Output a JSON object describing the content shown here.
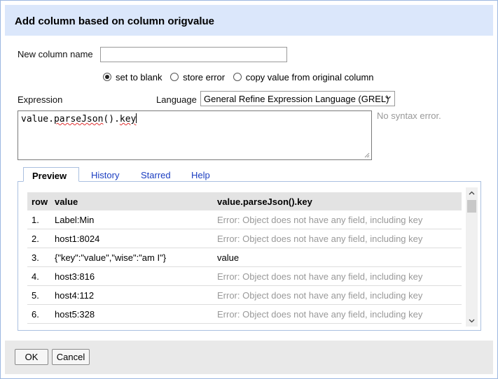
{
  "dialog": {
    "title": "Add column based on column origvalue",
    "new_column_label": "New column name",
    "new_column_value": "",
    "radios": [
      {
        "label": "set to blank",
        "checked": true
      },
      {
        "label": "store error",
        "checked": false
      },
      {
        "label": "copy value from original column",
        "checked": false
      }
    ],
    "expression_label": "Expression",
    "language_label": "Language",
    "language_value": "General Refine Expression Language (GREL)",
    "expression": {
      "part1": "value.",
      "part2": "parseJson",
      "part3": "().",
      "part4": "key"
    },
    "status": "No syntax error.",
    "tabs": [
      "Preview",
      "History",
      "Starred",
      "Help"
    ],
    "preview": {
      "headers": [
        "row",
        "value",
        "value.parseJson().key"
      ],
      "rows": [
        {
          "row": "1.",
          "value": "Label:Min",
          "result": "Error: Object does not have any field, including key",
          "error": true
        },
        {
          "row": "2.",
          "value": "host1:8024",
          "result": "Error: Object does not have any field, including key",
          "error": true
        },
        {
          "row": "3.",
          "value": "{\"key\":\"value\",\"wise\":\"am I\"}",
          "result": "value",
          "error": false
        },
        {
          "row": "4.",
          "value": "host3:816",
          "result": "Error: Object does not have any field, including key",
          "error": true
        },
        {
          "row": "5.",
          "value": "host4:112",
          "result": "Error: Object does not have any field, including key",
          "error": true
        },
        {
          "row": "6.",
          "value": "host5:328",
          "result": "Error: Object does not have any field, including key",
          "error": true
        }
      ]
    },
    "ok_label": "OK",
    "cancel_label": "Cancel"
  }
}
